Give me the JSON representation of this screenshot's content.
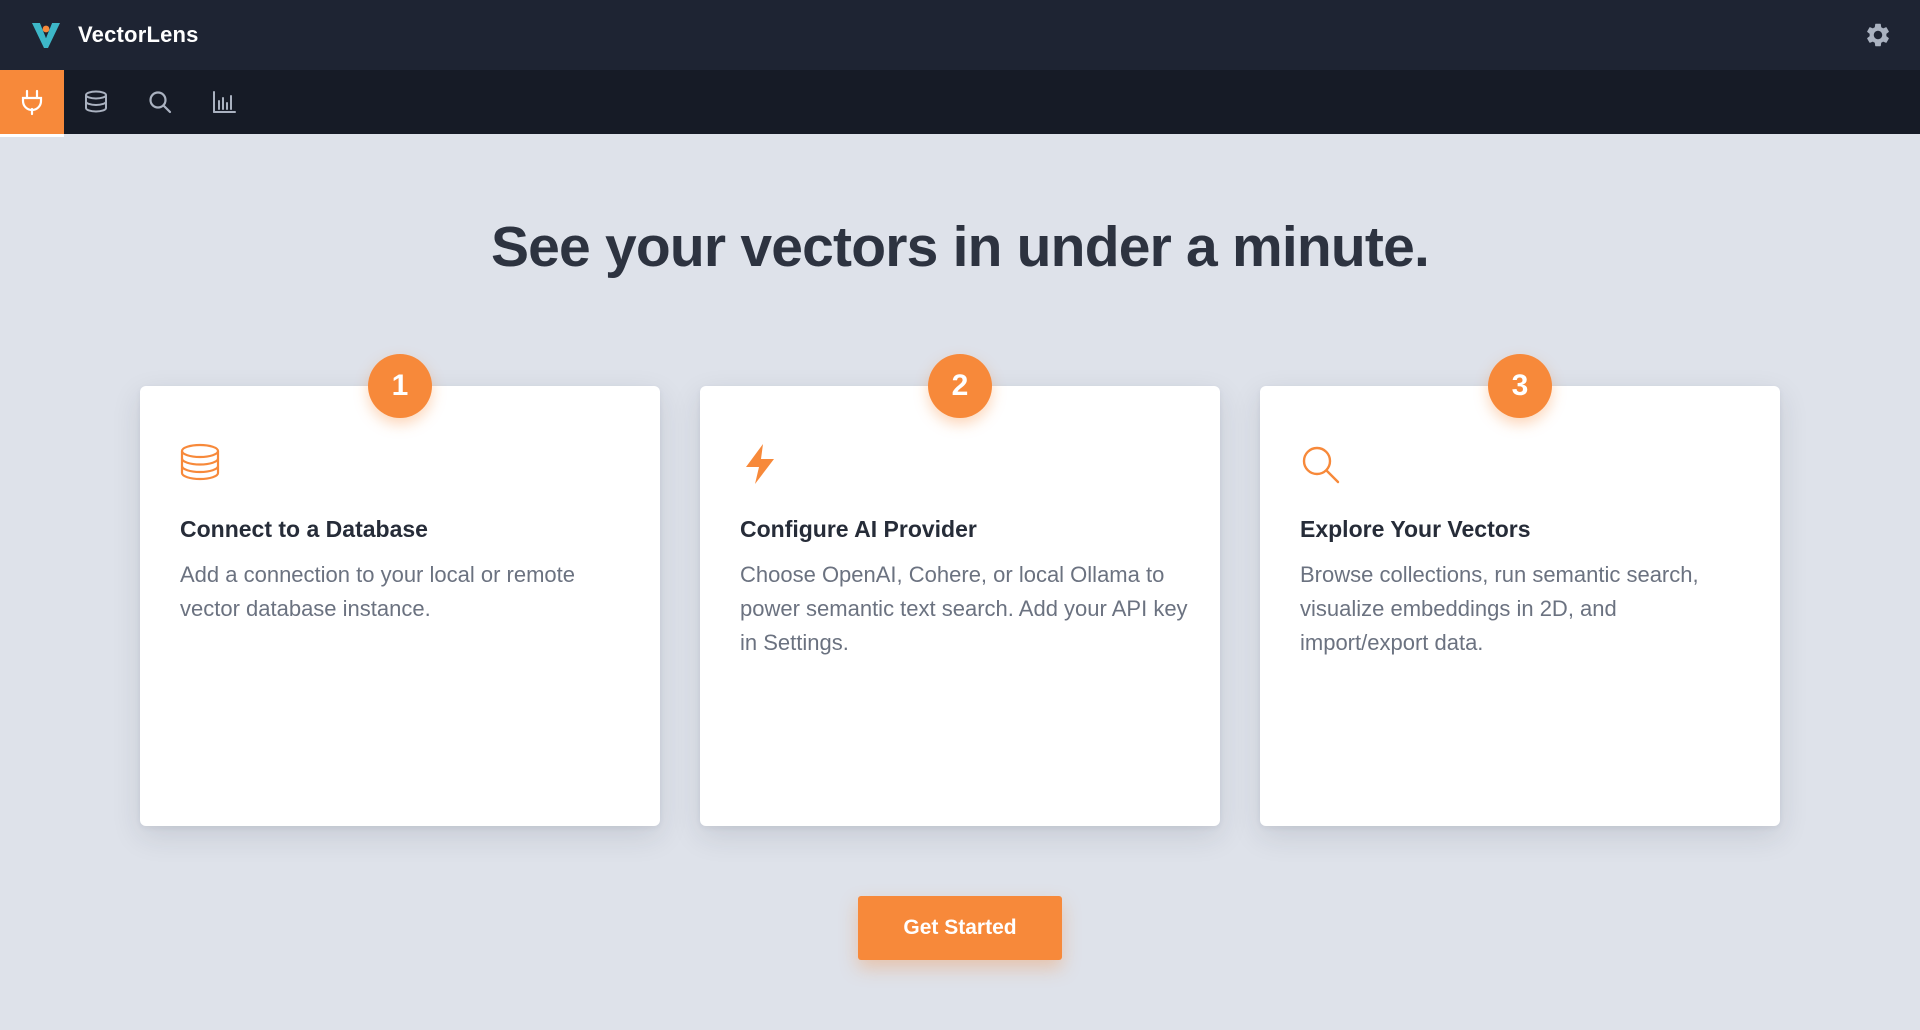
{
  "app": {
    "title": "VectorLens"
  },
  "colors": {
    "accent": "#f7893a",
    "titlebar": "#1e2433",
    "navbar": "#161b26",
    "background": "#dee2ea"
  },
  "nav": {
    "tabs": [
      {
        "name": "connections",
        "icon": "plug-icon",
        "active": true
      },
      {
        "name": "collections",
        "icon": "database-icon",
        "active": false
      },
      {
        "name": "search",
        "icon": "search-icon",
        "active": false
      },
      {
        "name": "visualize",
        "icon": "bar-chart-icon",
        "active": false
      }
    ]
  },
  "header": {
    "settings_icon": "gear-icon"
  },
  "main": {
    "headline": "See your vectors in under a minute.",
    "steps": [
      {
        "number": "1",
        "icon": "database-icon",
        "title": "Connect to a Database",
        "description": "Add a connection to your local or remote vector database instance."
      },
      {
        "number": "2",
        "icon": "lightning-icon",
        "title": "Configure AI Provider",
        "description": "Choose OpenAI, Cohere, or local Ollama to power semantic text search. Add your API key in Settings."
      },
      {
        "number": "3",
        "icon": "search-icon",
        "title": "Explore Your Vectors",
        "description": "Browse collections, run semantic search, visualize embeddings in 2D, and import/export data."
      }
    ],
    "cta_label": "Get Started"
  }
}
